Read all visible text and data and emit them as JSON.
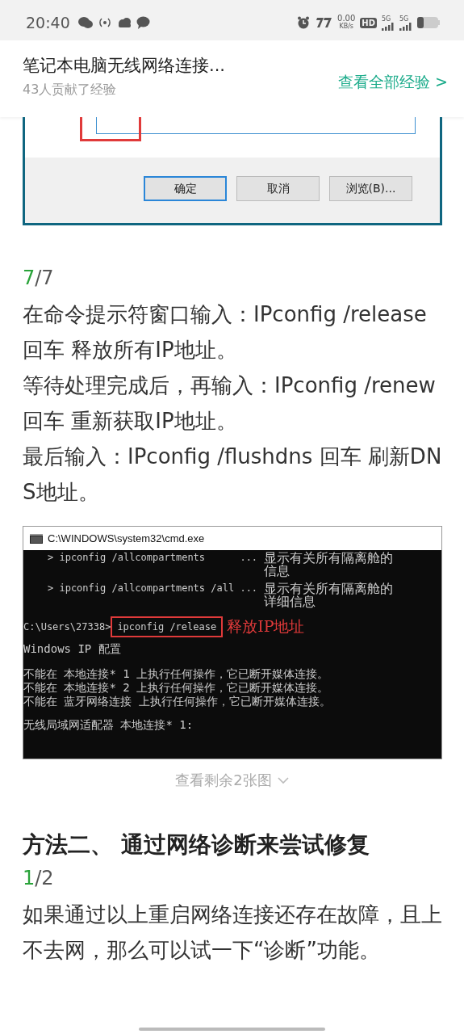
{
  "status_bar": {
    "time": "20:40",
    "net_speed": "0.00",
    "net_unit": "KB/s",
    "hd_label": "HD",
    "sims": [
      {
        "label": "5G"
      },
      {
        "label": "5G"
      }
    ]
  },
  "header": {
    "title": "笔记本电脑无线网络连接...",
    "subtitle": "43人贡献了经验",
    "link": "查看全部经验 >"
  },
  "run_dialog": {
    "buttons": [
      {
        "label": "确定",
        "selected": true
      },
      {
        "label": "取消",
        "selected": false
      },
      {
        "label": "浏览(B)...",
        "selected": false
      }
    ]
  },
  "step": {
    "current": "7",
    "total": "/7"
  },
  "paragraphs": [
    "在命令提示符窗口输入：IPconfig /release 回车 释放所有IP地址。",
    "等待处理完成后，再输入：IPconfig /renew 回车 重新获取IP地址。",
    "最后输入：IPconfig /flushdns 回车 刷新DNS地址。"
  ],
  "cmd_window": {
    "title": "C:\\WINDOWS\\system32\\cmd.exe",
    "lines": [
      {
        "kind": "option",
        "left": "> ipconfig /allcompartments      ...",
        "right": "显示有关所有隔离舱的信息"
      },
      {
        "kind": "option",
        "left": "> ipconfig /allcompartments /all ...",
        "right": "显示有关所有隔离舱的详细信息"
      },
      {
        "kind": "prompt",
        "prompt": "C:\\Users\\27338>",
        "command": "ipconfig /release",
        "note": "释放IP地址"
      },
      {
        "kind": "text",
        "text": "Windows IP 配置"
      },
      {
        "kind": "text",
        "text": "不能在 本地连接* 1 上执行任何操作，它已断开媒体连接。"
      },
      {
        "kind": "text",
        "text": "不能在 本地连接* 2 上执行任何操作，它已断开媒体连接。"
      },
      {
        "kind": "text",
        "text": "不能在 蓝牙网络连接 上执行任何操作，它已断开媒体连接。"
      },
      {
        "kind": "text",
        "text": "无线局域网适配器 本地连接* 1:"
      }
    ]
  },
  "more_images": "查看剩余2张图",
  "method": {
    "heading": "方法二、 通过网络诊断来尝试修复",
    "step": {
      "current": "1",
      "total": "/2"
    },
    "paragraphs": [
      "如果通过以上重启网络连接还存在故障，且上不去网，那么可以试一下“诊断”功能。"
    ]
  }
}
